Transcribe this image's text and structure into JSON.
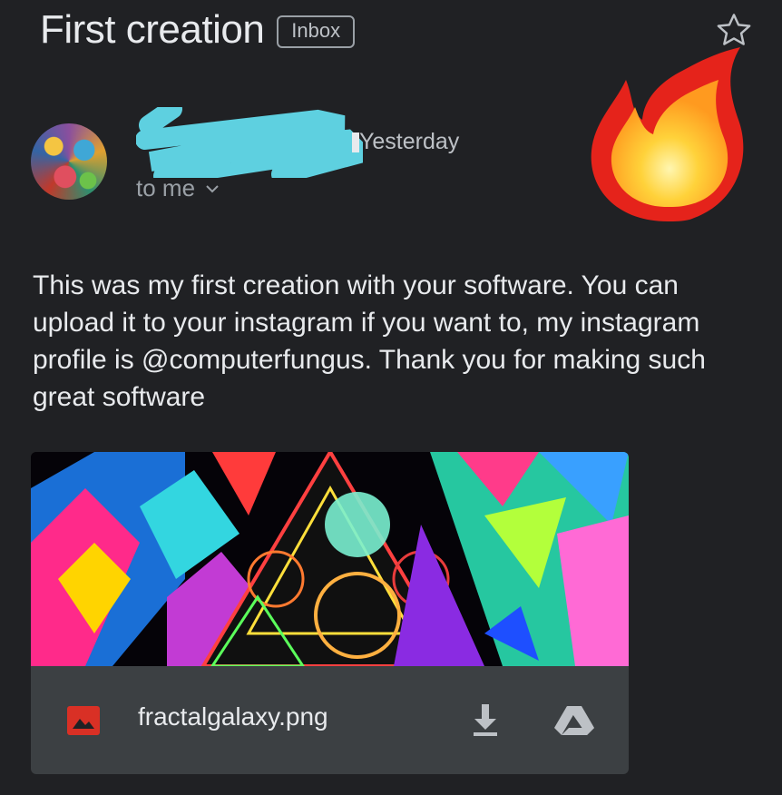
{
  "email": {
    "subject": "First creation",
    "label": "Inbox",
    "date": "Yesterday",
    "recipient": "to me",
    "body": "This was my first creation with your software. You can upload it to your instagram if you want to, my instagram profile is @computerfungus. Thank you for making such great software"
  },
  "attachment": {
    "filename": "fractalgalaxy.png"
  },
  "icons": {
    "star": "star-outline-icon",
    "chevron": "chevron-down-icon",
    "image": "image-file-icon",
    "download": "download-icon",
    "drive": "google-drive-icon",
    "sticker": "fire-emoji"
  },
  "colors": {
    "background": "#202124",
    "attachment_bar": "#3c4043",
    "image_icon": "#d93025",
    "redaction": "#5ed0e0"
  }
}
